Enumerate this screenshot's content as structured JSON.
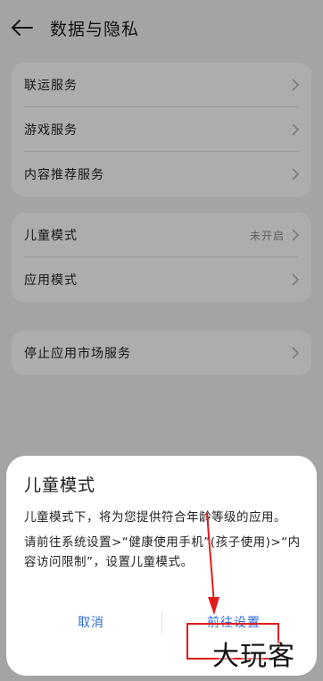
{
  "header": {
    "title": "数据与隐私"
  },
  "groups": [
    {
      "items": [
        {
          "label": "联运服务"
        },
        {
          "label": "游戏服务"
        },
        {
          "label": "内容推荐服务"
        }
      ]
    },
    {
      "items": [
        {
          "label": "儿童模式",
          "value": "未开启"
        },
        {
          "label": "应用模式"
        }
      ]
    },
    {
      "items": [
        {
          "label": "停止应用市场服务"
        }
      ]
    }
  ],
  "dialog": {
    "title": "儿童模式",
    "paragraphs": [
      "儿童模式下，将为您提供符合年龄等级的应用。",
      "请前往系统设置>“健康使用手机”(孩子使用)>“内容访问限制”，设置儿童模式。"
    ],
    "cancel_label": "取消",
    "confirm_label": "前往设置"
  },
  "watermark": "大玩客",
  "colors": {
    "accent": "#2f6be0",
    "annotation": "#e11c1c"
  },
  "icons": {
    "back": "arrow-left-icon",
    "chevron": "chevron-right-icon"
  }
}
